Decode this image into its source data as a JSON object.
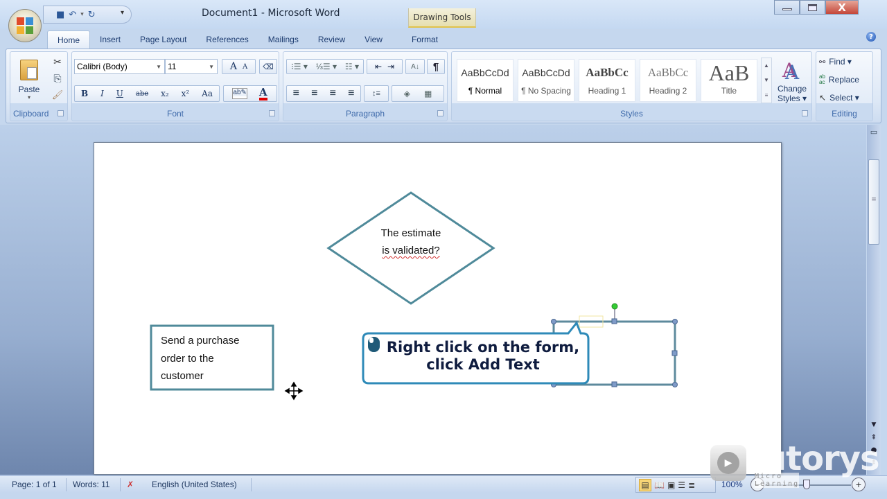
{
  "window": {
    "title": "Document1 - Microsoft Word",
    "contextual_tab_group": "Drawing Tools",
    "controls": {
      "minimize": "–",
      "maximize": "▭",
      "close": "X"
    }
  },
  "quick_access": {
    "save_icon": "💾",
    "undo_icon": "↶",
    "undo_dropdown": "▾",
    "redo_icon": "↻",
    "customize_icon": "▾"
  },
  "tabs": [
    {
      "label": "Home",
      "active": true
    },
    {
      "label": "Insert"
    },
    {
      "label": "Page Layout"
    },
    {
      "label": "References"
    },
    {
      "label": "Mailings"
    },
    {
      "label": "Review"
    },
    {
      "label": "View"
    },
    {
      "label": "Format",
      "contextual": true
    }
  ],
  "help_icon": "?",
  "ribbon": {
    "clipboard": {
      "label": "Clipboard",
      "paste": "Paste",
      "paste_arrow": "▾",
      "cut_icon": "✂",
      "copy_icon": "⎘",
      "format_painter_icon": "🖌"
    },
    "font": {
      "label": "Font",
      "font_name": "Calibri (Body)",
      "font_size": "11",
      "grow": "A",
      "shrink": "A",
      "clear_format": "A͢",
      "bold": "B",
      "italic": "I",
      "underline": "U",
      "strikethrough": "abe",
      "subscript": "x₂",
      "superscript": "x²",
      "change_case": "Aa",
      "highlight": "ab✎",
      "font_color": "A",
      "font_color_value": "#e00000"
    },
    "paragraph": {
      "label": "Paragraph",
      "bullets": "☰",
      "numbering": "☰",
      "multilevel": "☰",
      "decrease_indent": "⇤",
      "increase_indent": "⇥",
      "sort": "A↓",
      "show_marks": "¶",
      "align_left": "≡",
      "center": "≡",
      "align_right": "≡",
      "justify": "≡",
      "line_spacing": "↕≡",
      "shading": "◈",
      "borders": "▦"
    },
    "styles": {
      "label": "Styles",
      "items": [
        {
          "preview": "AaBbCcDd",
          "name": "¶ Normal"
        },
        {
          "preview": "AaBbCcDd",
          "name": "¶ No Spacing"
        },
        {
          "preview": "AaBbCc",
          "name": "Heading 1"
        },
        {
          "preview": "AaBbCc",
          "name": "Heading 2"
        },
        {
          "preview": "AaB",
          "name": "Title"
        }
      ],
      "change_styles": "Change Styles ▾",
      "change_line1": "Change",
      "change_line2": "Styles ▾"
    },
    "editing": {
      "label": "Editing",
      "find": "Find ▾",
      "replace": "Replace",
      "select": "Select ▾"
    }
  },
  "document": {
    "decision_text_line1": "The estimate",
    "decision_text_line2": "is validated?",
    "process_text_line1": "Send a purchase",
    "process_text_line2": "order to the",
    "process_text_line3": "customer",
    "shape_stroke": "#4f8a9a",
    "selection_handle_color": "#7f9bc8",
    "rotation_handle_color": "#33cc33"
  },
  "callout": {
    "line1": "Right click on the form,",
    "line2": "click Add Text",
    "border_color": "#2e8ab8"
  },
  "statusbar": {
    "page": "Page: 1 of 1",
    "words": "Words: 11",
    "language": "English (United States)",
    "zoom": "100%",
    "zoom_out": "−",
    "zoom_in": "+"
  },
  "watermark": {
    "brand": "tutorys",
    "tagline": "Micro Learning"
  }
}
